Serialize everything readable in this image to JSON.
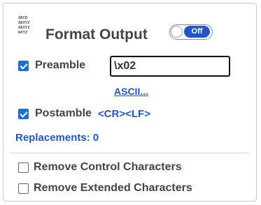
{
  "format_output": {
    "icon_lines": [
      "ABCD",
      "ABXYZ",
      "ABXYZ",
      "WXYZ"
    ],
    "title": "Format Output",
    "toggle_state": "Off"
  },
  "preamble": {
    "label": "Preamble",
    "checked": true,
    "value": "\\x02",
    "ascii_link": "ASCII..."
  },
  "postamble": {
    "label": "Postamble",
    "checked": true,
    "value": "<CR><LF>"
  },
  "replacements": {
    "label": "Replacements: 0"
  },
  "options": {
    "remove_control": {
      "label": "Remove Control Characters",
      "checked": false
    },
    "remove_extended": {
      "label": "Remove Extended Characters",
      "checked": false
    }
  }
}
